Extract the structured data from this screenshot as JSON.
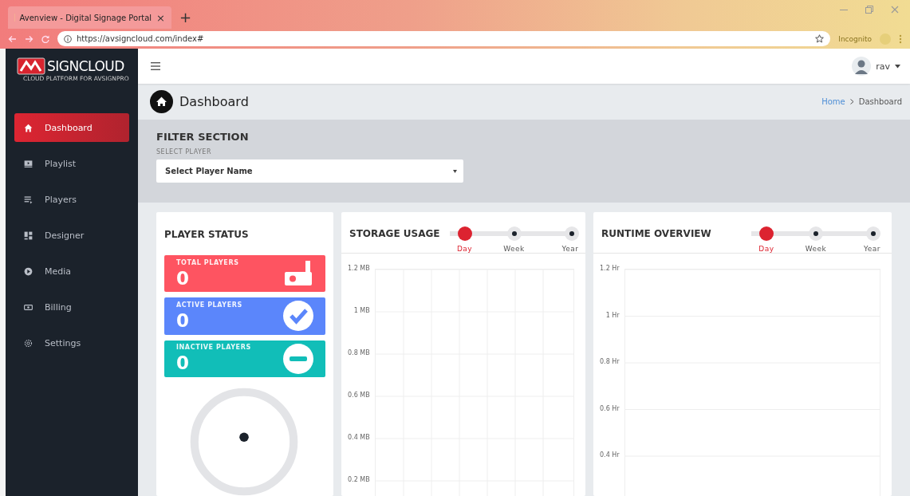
{
  "browser": {
    "tab_title": "Avenview - Digital Signage Portal",
    "tab_close": "×",
    "new_tab": "+",
    "url": "https://avsigncloud.com/index#",
    "incognito": "Incognito"
  },
  "logo": {
    "text": "SIGNCLOUD",
    "tagline": "CLOUD PLATFORM FOR AVSIGNPRO"
  },
  "sidebar": {
    "items": [
      {
        "label": "Dashboard",
        "selected": true
      },
      {
        "label": "Playlist",
        "selected": false
      },
      {
        "label": "Players",
        "selected": false
      },
      {
        "label": "Designer",
        "selected": false
      },
      {
        "label": "Media",
        "selected": false
      },
      {
        "label": "Billing",
        "selected": false
      },
      {
        "label": "Settings",
        "selected": false
      }
    ]
  },
  "header": {
    "user": "rav"
  },
  "page_header": {
    "title": "Dashboard",
    "breadcrumb": [
      "Home",
      "Dashboard"
    ]
  },
  "filter": {
    "title": "FILTER SECTION",
    "label": "SELECT PLAYER",
    "select_value": "Select Player Name"
  },
  "player_status": {
    "title": "PLAYER STATUS",
    "stats": [
      {
        "label": "TOTAL PLAYERS",
        "value": "0",
        "kind": "total",
        "color": "#fe5461"
      },
      {
        "label": "ACTIVE PLAYERS",
        "value": "0",
        "kind": "active",
        "color": "#5b86fb"
      },
      {
        "label": "INACTIVE PLAYERS",
        "value": "0",
        "kind": "inactive",
        "color": "#11beb8"
      }
    ]
  },
  "storage_usage": {
    "title": "STORAGE USAGE",
    "periods": [
      {
        "label": "Day",
        "selected": true
      },
      {
        "label": "Week",
        "selected": false
      },
      {
        "label": "Year",
        "selected": false
      }
    ],
    "y_axis_labels": [
      "1.2 MB",
      "1 MB",
      "0.8 MB",
      "0.6 MB",
      "0.4 MB",
      "0.2 MB"
    ]
  },
  "runtime_overview": {
    "title": "RUNTIME OVERVIEW",
    "periods": [
      {
        "label": "Day",
        "selected": true
      },
      {
        "label": "Week",
        "selected": false
      },
      {
        "label": "Year",
        "selected": false
      }
    ],
    "y_axis_labels": [
      "1.2 Hr",
      "1 Hr",
      "0.8 Hr",
      "0.6 Hr",
      "0.4 Hr"
    ]
  }
}
